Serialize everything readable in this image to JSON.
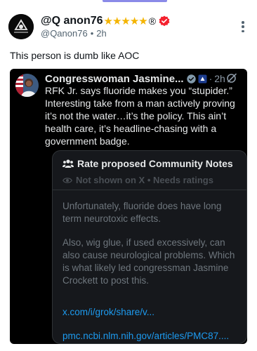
{
  "post": {
    "display_name": "@Q anon76",
    "stars": "★★★★★",
    "registered_mark": "®",
    "handle": "@Qanon76",
    "separator": "•",
    "time": "2h",
    "text": "This person is dumb like AOC"
  },
  "quote": {
    "author_name": "Congresswoman Jasmine...",
    "separator": "·",
    "time": "2h",
    "text": "RFK Jr. says fluoride makes you “stupider.” Interesting take from a man actively proving it’s not the water…it’s the policy. This ain’t health care, it’s headline-chasing with a government badge."
  },
  "community_notes": {
    "title": "Rate proposed Community Notes",
    "status": "Not shown on X • Needs ratings",
    "paragraph_1": "Unfortunately, fluoride does have long term neurotoxic effects.",
    "paragraph_2": "Also, wig glue, if used excessively, can also cause neurological problems. Which is what likely led congressman Jasmine Crockett to post this.",
    "link_1": "x.com/i/grok/share/v...",
    "link_2": "pmc.ncbi.nlm.nih.gov/articles/PMC87...."
  },
  "colors": {
    "star": "#f4b400",
    "verified_badge": "#f4212e",
    "quote_bg": "#000000",
    "link": "#1d9bf0",
    "indicator": "#8a8ae8"
  },
  "icons": [
    "more-vertical-icon",
    "verified-badge-icon",
    "gov-badge-icon",
    "flag-icon",
    "grok-icon",
    "people-icon",
    "eye-icon"
  ]
}
